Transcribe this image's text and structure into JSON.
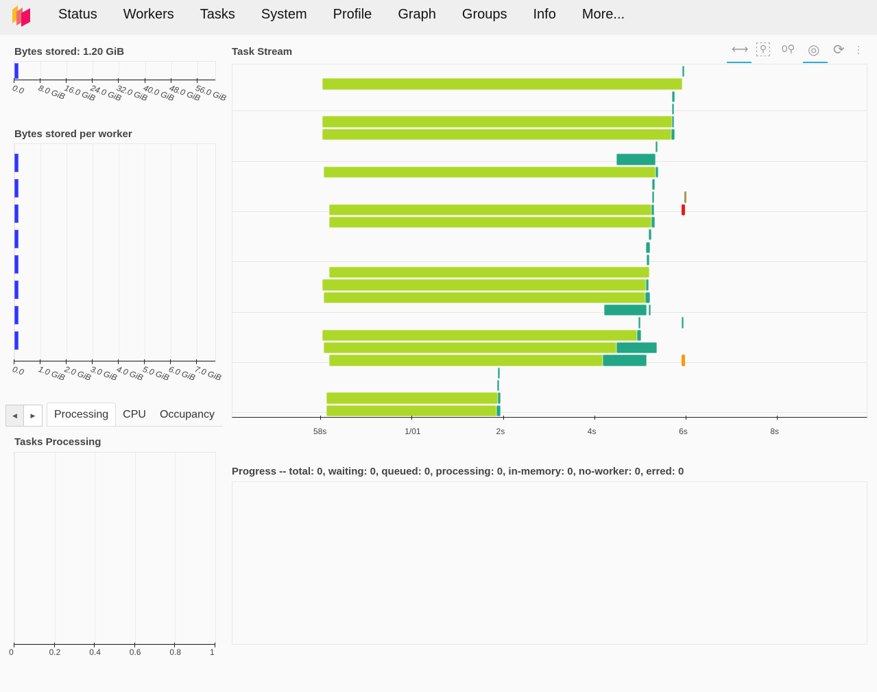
{
  "nav": {
    "items": [
      "Status",
      "Workers",
      "Tasks",
      "System",
      "Profile",
      "Graph",
      "Groups",
      "Info",
      "More..."
    ]
  },
  "bytes_stored": {
    "title": "Bytes stored: 1.20 GiB",
    "value_gib": 1.2,
    "xlim": [
      0,
      61.5
    ],
    "ticks": [
      "0.0",
      "8.0 GiB",
      "16.0 GiB",
      "24.0 GiB",
      "32.0 GiB",
      "40.0 GiB",
      "48.0 GiB",
      "56.0 GiB"
    ],
    "bar_color": "#3333ff"
  },
  "bytes_per_worker": {
    "title": "Bytes stored per worker",
    "values_gib": [
      0.15,
      0.15,
      0.15,
      0.15,
      0.15,
      0.15,
      0.15,
      0.15
    ],
    "xlim": [
      0,
      7.7
    ],
    "ticks": [
      "0.0",
      "1.0 GiB",
      "2.0 GiB",
      "3.0 GiB",
      "4.0 GiB",
      "5.0 GiB",
      "6.0 GiB",
      "7.0 GiB"
    ]
  },
  "tabs": {
    "items": [
      "Processing",
      "CPU",
      "Occupancy"
    ],
    "active": "Processing"
  },
  "tasks_processing": {
    "title": "Tasks Processing",
    "xlim": [
      0,
      1
    ],
    "ticks": [
      "0",
      "0.2",
      "0.4",
      "0.6",
      "0.8",
      "1"
    ]
  },
  "task_stream": {
    "title": "Task Stream",
    "tools": [
      "pan",
      "box-zoom",
      "wheel-zoom",
      "tap-zoom",
      "reset",
      "more"
    ],
    "xlim": [
      -3.92,
      9.96
    ],
    "ticks": [
      {
        "label": "58s",
        "t": -2
      },
      {
        "label": "1/01",
        "t": 0
      },
      {
        "label": "2s",
        "t": 2
      },
      {
        "label": "4s",
        "t": 4
      },
      {
        "label": "6s",
        "t": 6
      },
      {
        "label": "8s",
        "t": 8
      }
    ],
    "colors": {
      "g": "#add82a",
      "t": "#23a685",
      "r": "#e51c1c",
      "o": "#a89a50",
      "y": "#ff9900"
    },
    "rows": [
      [
        [
          5.93,
          5.97,
          "t"
        ]
      ],
      [
        [
          -1.96,
          5.93,
          "g"
        ]
      ],
      [
        [
          5.7,
          5.76,
          "t"
        ]
      ],
      [
        [
          5.7,
          5.75,
          "t"
        ]
      ],
      [
        [
          -1.96,
          5.7,
          "g"
        ],
        [
          5.7,
          5.75,
          "t"
        ]
      ],
      [
        [
          -1.96,
          5.69,
          "g"
        ],
        [
          5.69,
          5.76,
          "t"
        ]
      ],
      [
        [
          5.34,
          5.39,
          "t"
        ]
      ],
      [
        [
          4.49,
          5.34,
          "t"
        ]
      ],
      [
        [
          -1.92,
          5.34,
          "g"
        ],
        [
          5.34,
          5.4,
          "t"
        ]
      ],
      [
        [
          5.27,
          5.33,
          "t"
        ]
      ],
      [
        [
          5.27,
          5.31,
          "t"
        ],
        [
          5.97,
          6.02,
          "o"
        ]
      ],
      [
        [
          -1.81,
          5.25,
          "g"
        ],
        [
          5.25,
          5.31,
          "t"
        ],
        [
          5.91,
          5.99,
          "r"
        ]
      ],
      [
        [
          -1.81,
          5.25,
          "g"
        ],
        [
          5.25,
          5.33,
          "t"
        ]
      ],
      [
        [
          5.19,
          5.25,
          "t"
        ]
      ],
      [
        [
          5.13,
          5.22,
          "t"
        ]
      ],
      [
        [
          5.15,
          5.21,
          "t"
        ]
      ],
      [
        [
          -1.81,
          5.21,
          "g"
        ]
      ],
      [
        [
          -1.95,
          5.13,
          "g"
        ],
        [
          5.13,
          5.19,
          "t"
        ]
      ],
      [
        [
          -1.93,
          5.12,
          "g"
        ],
        [
          5.12,
          5.22,
          "t"
        ]
      ],
      [
        [
          4.21,
          5.15,
          "t"
        ],
        [
          5.19,
          5.24,
          "t"
        ]
      ],
      [
        [
          4.96,
          5.0,
          "t"
        ],
        [
          5.91,
          5.96,
          "t"
        ]
      ],
      [
        [
          -1.96,
          4.94,
          "g"
        ],
        [
          4.94,
          5.03,
          "t"
        ]
      ],
      [
        [
          -1.93,
          4.48,
          "g"
        ],
        [
          4.48,
          5.37,
          "t"
        ]
      ],
      [
        [
          -1.81,
          4.19,
          "g"
        ],
        [
          4.19,
          5.15,
          "t"
        ],
        [
          5.91,
          5.99,
          "y"
        ]
      ],
      [
        [
          1.89,
          1.93,
          "t"
        ]
      ],
      [
        [
          1.87,
          1.92,
          "t"
        ]
      ],
      [
        [
          -1.87,
          1.89,
          "g"
        ],
        [
          1.89,
          1.95,
          "t"
        ]
      ],
      [
        [
          -1.87,
          1.86,
          "g"
        ],
        [
          1.86,
          1.95,
          "t"
        ]
      ]
    ]
  },
  "progress": {
    "title": "Progress -- total: 0, waiting: 0, queued: 0, processing: 0, in-memory: 0, no-worker: 0, erred: 0"
  }
}
